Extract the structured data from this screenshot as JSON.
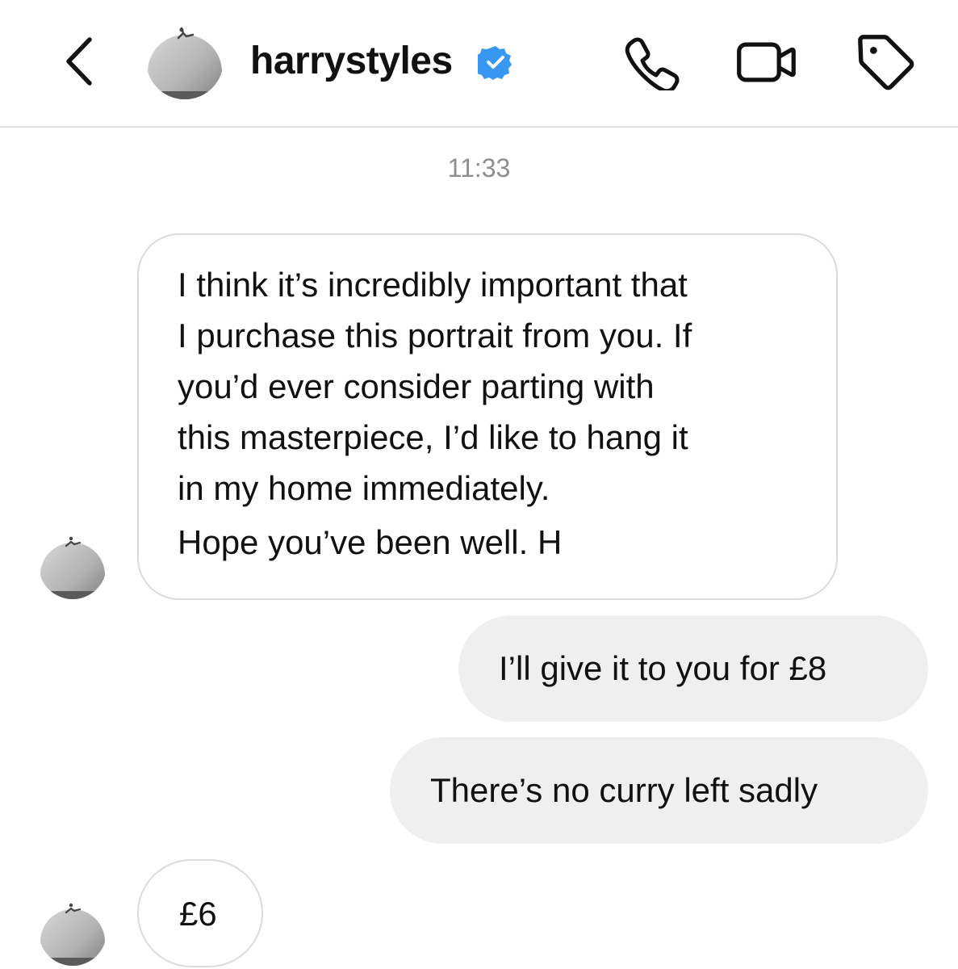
{
  "header": {
    "username": "harrystyles",
    "verified": true,
    "icons": {
      "back": "chevron-left-icon",
      "call": "phone-icon",
      "video": "video-camera-icon",
      "label": "tag-icon",
      "verified": "verified-badge-icon"
    }
  },
  "thread": {
    "timestamp": "11:33",
    "messages": [
      {
        "direction": "incoming",
        "lines": [
          "I think it’s incredibly important that",
          "I purchase this portrait from you. If",
          "you’d ever consider parting with",
          "this masterpiece, I’d like to hang it",
          "in my home immediately.",
          "Hope you’ve been well. H"
        ]
      },
      {
        "direction": "outgoing",
        "text": "I’ll give it to you for £8"
      },
      {
        "direction": "outgoing",
        "text": "There’s no curry left sadly"
      },
      {
        "direction": "incoming",
        "text": "£6"
      }
    ]
  },
  "colors": {
    "verified_blue": "#3897f0",
    "outgoing_bubble": "#efefef",
    "incoming_border": "#dbdbdb",
    "timestamp": "#8e8e8e",
    "divider": "#e4e4e4"
  }
}
